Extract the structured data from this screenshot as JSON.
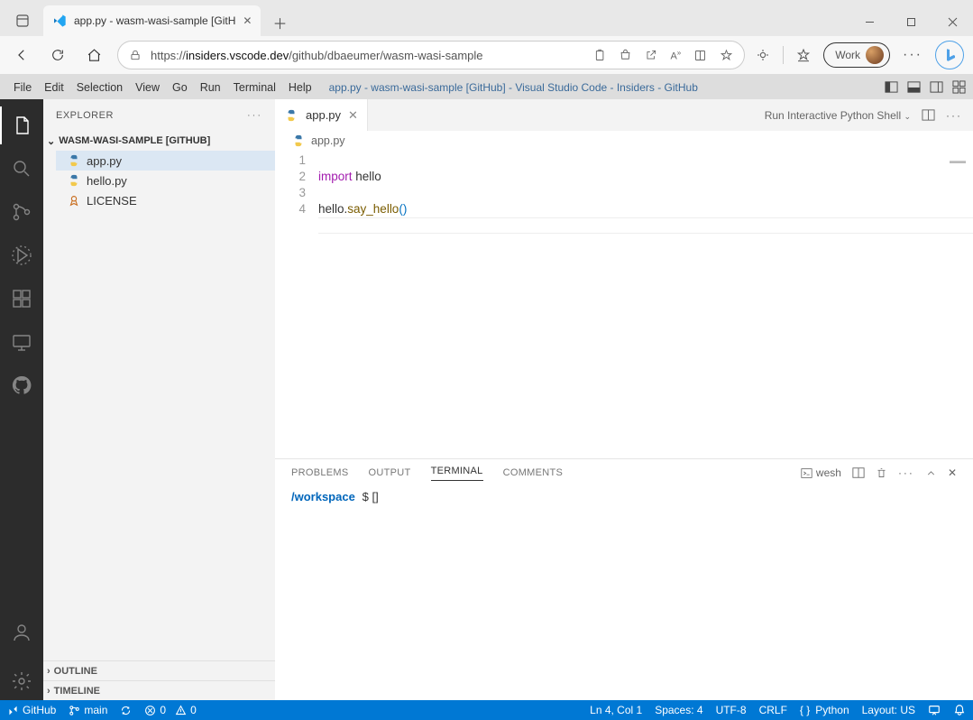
{
  "browser": {
    "tab_title": "app.py - wasm-wasi-sample [GitH",
    "url_prefix": "https://",
    "url_host": "insiders.vscode.dev",
    "url_path": "/github/dbaeumer/wasm-wasi-sample",
    "work_label": "Work"
  },
  "menubar": {
    "items": [
      "File",
      "Edit",
      "Selection",
      "View",
      "Go",
      "Run",
      "Terminal",
      "Help"
    ],
    "title": "app.py - wasm-wasi-sample [GitHub] - Visual Studio Code - Insiders - GitHub"
  },
  "sidebar": {
    "header": "EXPLORER",
    "section": "WASM-WASI-SAMPLE [GITHUB]",
    "files": [
      {
        "name": "app.py",
        "type": "py",
        "selected": true
      },
      {
        "name": "hello.py",
        "type": "py",
        "selected": false
      },
      {
        "name": "LICENSE",
        "type": "license",
        "selected": false
      }
    ],
    "outline": "OUTLINE",
    "timeline": "TIMELINE"
  },
  "editor": {
    "tab_name": "app.py",
    "breadcrumb": "app.py",
    "run_label": "Run Interactive Python Shell",
    "code_lines": [
      {
        "n": "1",
        "html": "<span class='kw'>import</span> hello"
      },
      {
        "n": "2",
        "html": ""
      },
      {
        "n": "3",
        "html": "hello.<span class='fn'>say_hello</span><span class='paren'>()</span>"
      },
      {
        "n": "4",
        "html": ""
      }
    ]
  },
  "panel": {
    "tabs": [
      "PROBLEMS",
      "OUTPUT",
      "TERMINAL",
      "COMMENTS"
    ],
    "active_tab": "TERMINAL",
    "shell_name": "wesh",
    "cwd": "/workspace",
    "prompt": "$",
    "cursor": "[]"
  },
  "statusbar": {
    "remote": "GitHub",
    "branch": "main",
    "errors": "0",
    "warnings": "0",
    "ln_col": "Ln 4, Col 1",
    "spaces": "Spaces: 4",
    "encoding": "UTF-8",
    "eol": "CRLF",
    "lang": "Python",
    "layout": "Layout: US"
  }
}
